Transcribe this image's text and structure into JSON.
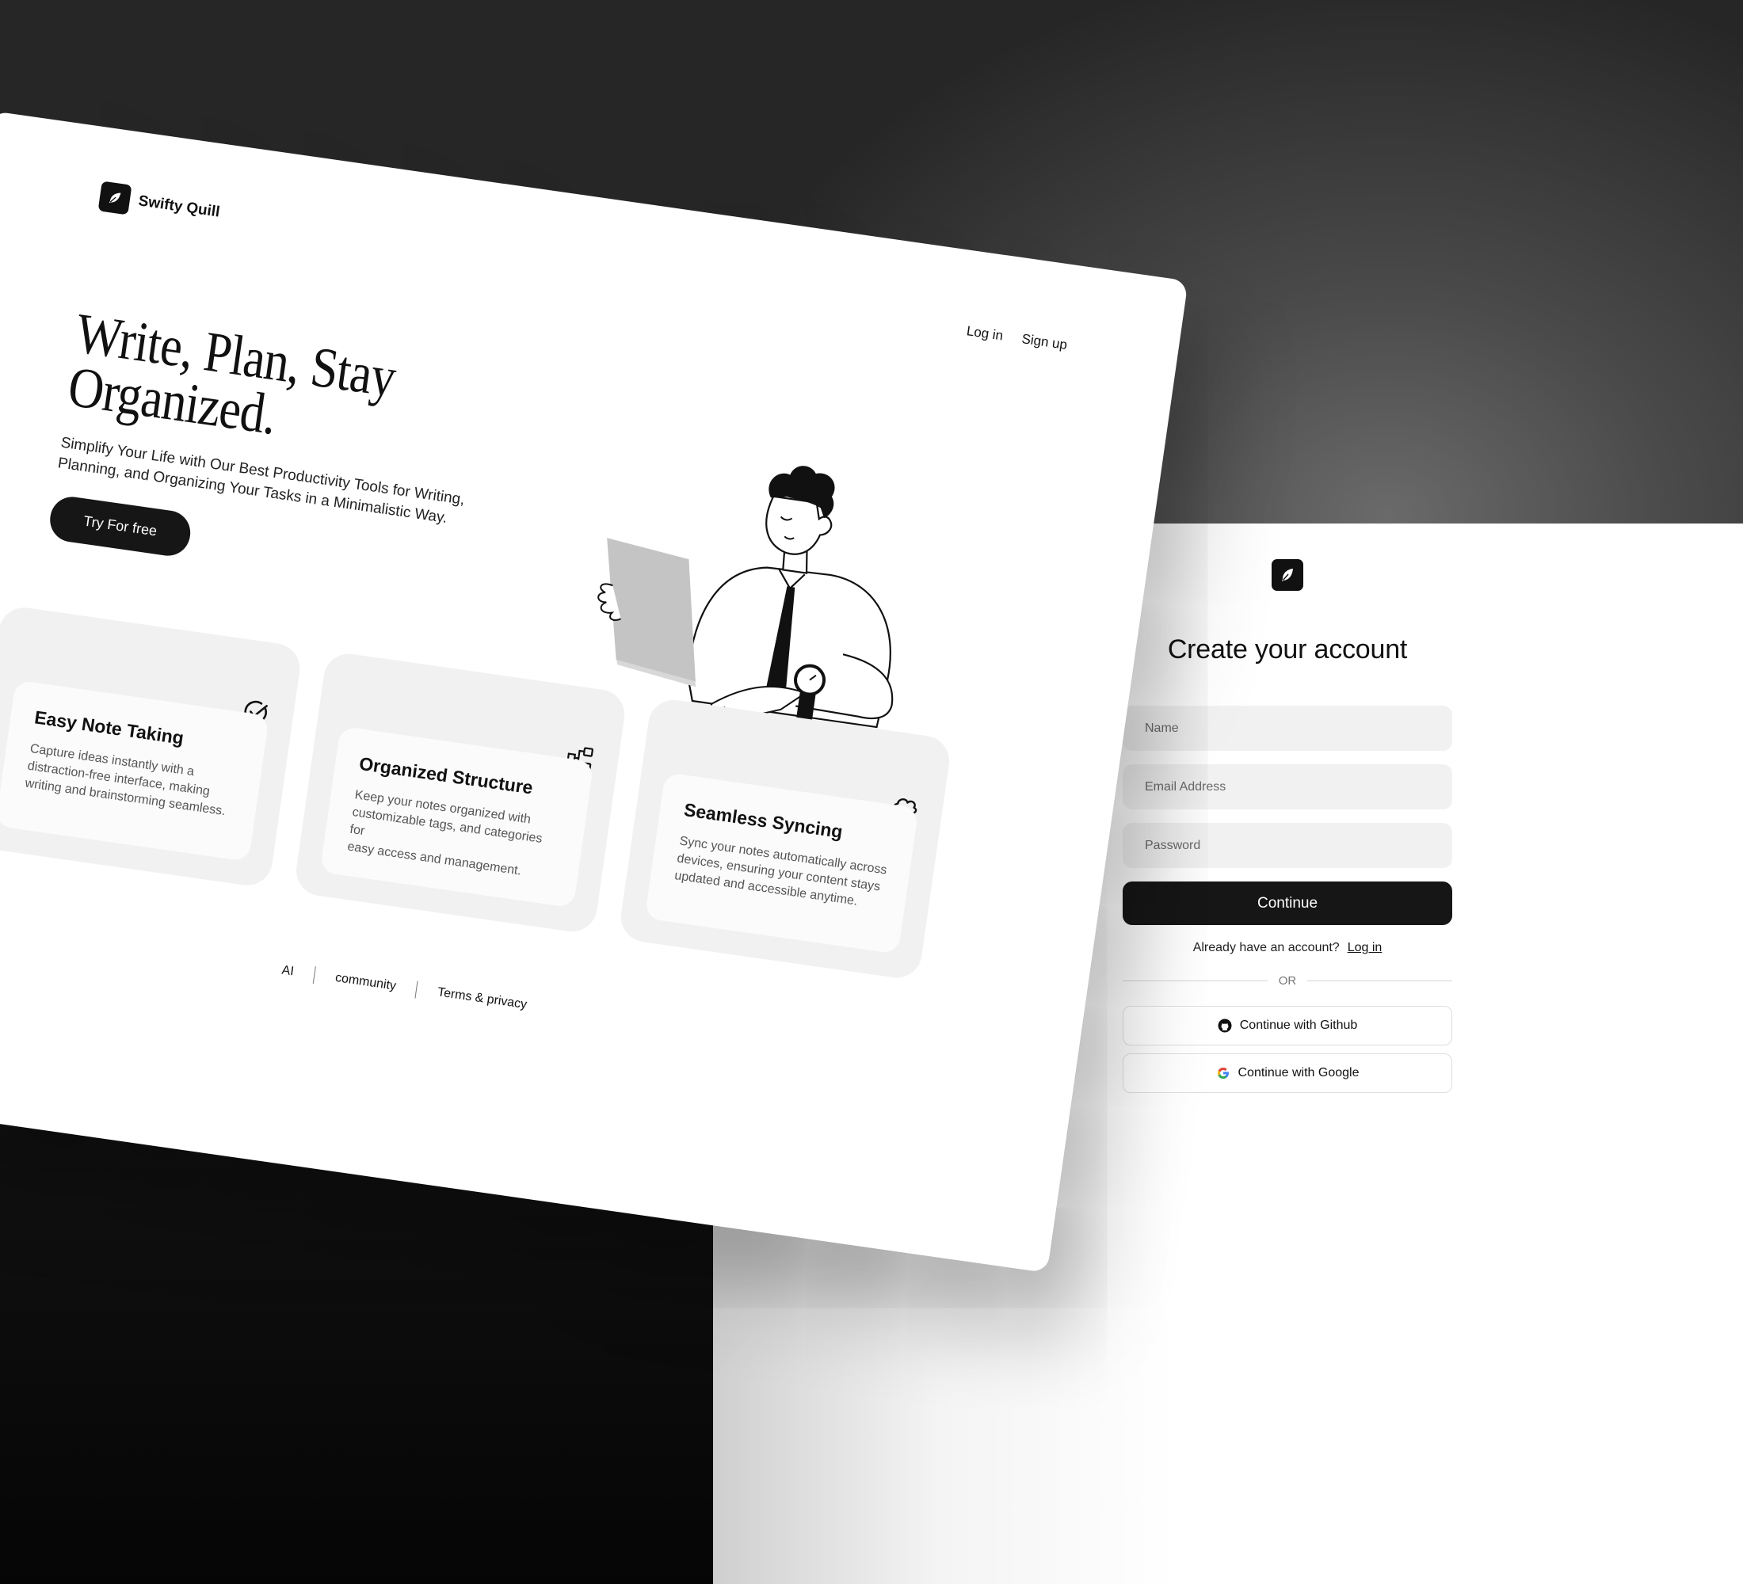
{
  "landing": {
    "brand_name": "Swifty Quill",
    "nav": {
      "login": "Log in",
      "signup": "Sign up"
    },
    "hero": {
      "title_line1": "Write, Plan, Stay",
      "title_line2": "Organized.",
      "subtitle_line1": "Simplify Your Life with Our Best Productivity Tools for Writing,",
      "subtitle_line2": "Planning, and Organizing Your Tasks in a Minimalistic Way.",
      "cta": "Try For free"
    },
    "features": [
      {
        "icon": "check-circle-icon",
        "title": "Easy Note Taking",
        "desc_line1": "Capture ideas instantly with a",
        "desc_line2": "distraction-free interface, making",
        "desc_line3": "writing and brainstorming seamless."
      },
      {
        "icon": "hierarchy-icon",
        "title": "Organized Structure",
        "desc_line1": "Keep your notes organized with",
        "desc_line2": "customizable tags, and categories for",
        "desc_line3": "easy access and management."
      },
      {
        "icon": "cloud-icon",
        "title": "Seamless Syncing",
        "desc_line1": "Sync your notes automatically across",
        "desc_line2": "devices, ensuring your content stays",
        "desc_line3": "updated and accessible anytime."
      }
    ],
    "footer": {
      "ai": "AI",
      "community": "community",
      "terms": "Terms & privacy"
    }
  },
  "signup": {
    "title": "Create your account",
    "fields": {
      "name_placeholder": "Name",
      "email_placeholder": "Email Address",
      "password_placeholder": "Password"
    },
    "continue": "Continue",
    "have_account": "Already have an account?",
    "login_link": "Log in",
    "or": "OR",
    "github": "Continue with Github",
    "google": "Continue with Google"
  },
  "colors": {
    "primary": "#161616",
    "card_bg": "#f1f1f1",
    "field_bg": "#f1f1f1",
    "accent_gray": "#c4c4c4"
  }
}
